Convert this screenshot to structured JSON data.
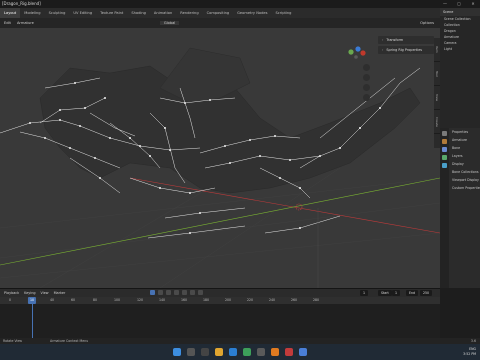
{
  "window": {
    "title": "[Dragon_Rig.blend]",
    "controls": [
      "—",
      "▢",
      "✕"
    ]
  },
  "workspace_tabs": [
    "Layout",
    "Modeling",
    "Sculpting",
    "UV Editing",
    "Texture Paint",
    "Shading",
    "Animation",
    "Rendering",
    "Compositing",
    "Geometry Nodes",
    "Scripting"
  ],
  "active_tab": "Layout",
  "header": {
    "mode": "Edit",
    "menu_item": "Armature",
    "transform_orientation": "Global",
    "options_label": "Options"
  },
  "viewport": {
    "panels": [
      "Transform",
      "Spring Rig Properties"
    ],
    "side_tabs": [
      "Item",
      "Tool",
      "View",
      "Create"
    ]
  },
  "outliner": {
    "title": "Scene",
    "items": [
      "Scene Collection",
      "Collection",
      "Dragon",
      "Armature",
      "Camera",
      "Light"
    ]
  },
  "properties": {
    "rows": [
      "Properties",
      "Armature",
      "Bone",
      "Layers",
      "Display",
      "Bone Collections",
      "Viewport Display",
      "Custom Properties"
    ]
  },
  "timeline": {
    "menu": [
      "Playback",
      "Keying",
      "View",
      "Marker"
    ],
    "current_frame": "1",
    "start_label": "Start",
    "start": "1",
    "end_label": "End",
    "end": "250",
    "ruler": [
      "0",
      "10",
      "40",
      "60",
      "80",
      "100",
      "120",
      "140",
      "160",
      "180",
      "200",
      "220",
      "240",
      "260",
      "280"
    ]
  },
  "statusbar": {
    "left": "Rotate View",
    "middle": "Armature Context Menu",
    "right": "3.6"
  },
  "taskbar": {
    "tray_lines": [
      "ENG",
      "3:52 PM"
    ]
  },
  "colors": {
    "accent": "#4772b3",
    "viewport_bg": "#393939",
    "bone": "#e8e8e8",
    "x_axis": "#c03a3a",
    "y_axis": "#7ab332"
  }
}
